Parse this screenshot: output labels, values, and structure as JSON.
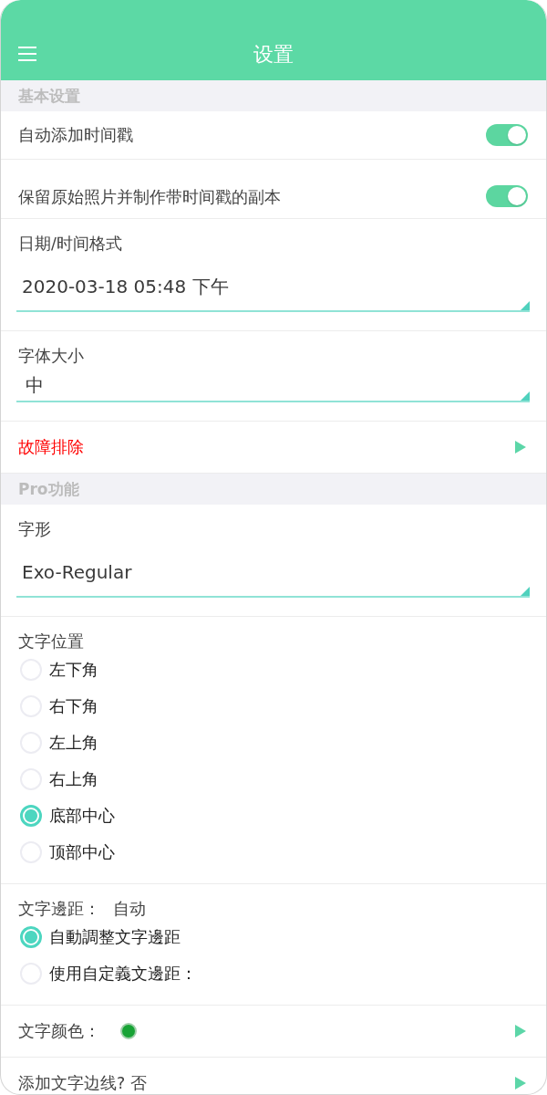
{
  "header": {
    "title": "设置"
  },
  "sections": [
    {
      "title": "基本设置",
      "items": [
        {
          "kind": "toggle",
          "label": "自动添加时间戳",
          "on": true
        },
        {
          "kind": "toggle",
          "label": "保留原始照片并制作带时间戳的副本",
          "on": true
        },
        {
          "kind": "dropdown",
          "label": "日期/时间格式",
          "value": "2020-03-18 05:48 下午"
        },
        {
          "kind": "select",
          "label": "字体大小",
          "value": "中"
        },
        {
          "kind": "link",
          "label": "故障排除",
          "alert": true
        }
      ]
    },
    {
      "title": "Pro功能",
      "items": [
        {
          "kind": "dropdown",
          "label": "字形",
          "value": "Exo-Regular"
        },
        {
          "kind": "radios",
          "label": "文字位置",
          "options": [
            {
              "label": "左下角",
              "selected": false
            },
            {
              "label": "右下角",
              "selected": false
            },
            {
              "label": "左上角",
              "selected": false
            },
            {
              "label": "右上角",
              "selected": false
            },
            {
              "label": "底部中心",
              "selected": true
            },
            {
              "label": "顶部中心",
              "selected": false
            }
          ]
        },
        {
          "kind": "radios",
          "label": "文字邊距：",
          "value": "自动",
          "options": [
            {
              "label": "自動調整文字邊距",
              "selected": true
            },
            {
              "label": "使用自定義文邊距：",
              "selected": false
            }
          ]
        },
        {
          "kind": "color",
          "label": "文字颜色：",
          "color": "#17a335"
        },
        {
          "kind": "link",
          "label": "添加文字边线? 否",
          "alert": false
        }
      ]
    }
  ]
}
